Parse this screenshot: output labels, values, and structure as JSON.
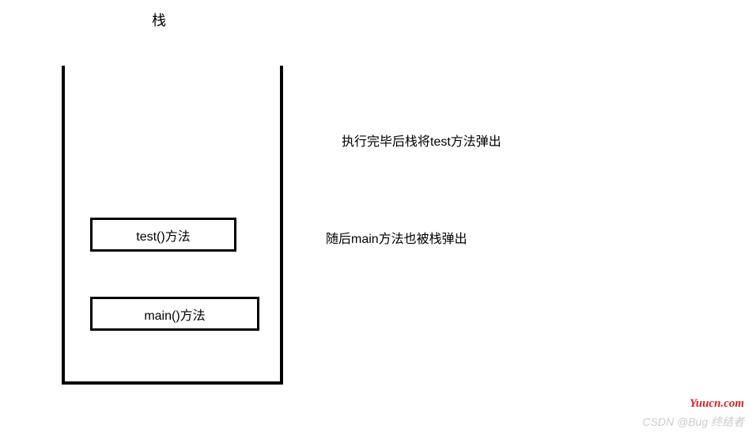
{
  "title": "栈",
  "stack": {
    "frames": [
      {
        "label": "test()方法"
      },
      {
        "label": "main()方法"
      }
    ]
  },
  "annotations": [
    "执行完毕后栈将test方法弹出",
    "随后main方法也被栈弹出"
  ],
  "watermarks": {
    "site": "Yuucn.com",
    "author": "CSDN @Bug 终结者"
  }
}
